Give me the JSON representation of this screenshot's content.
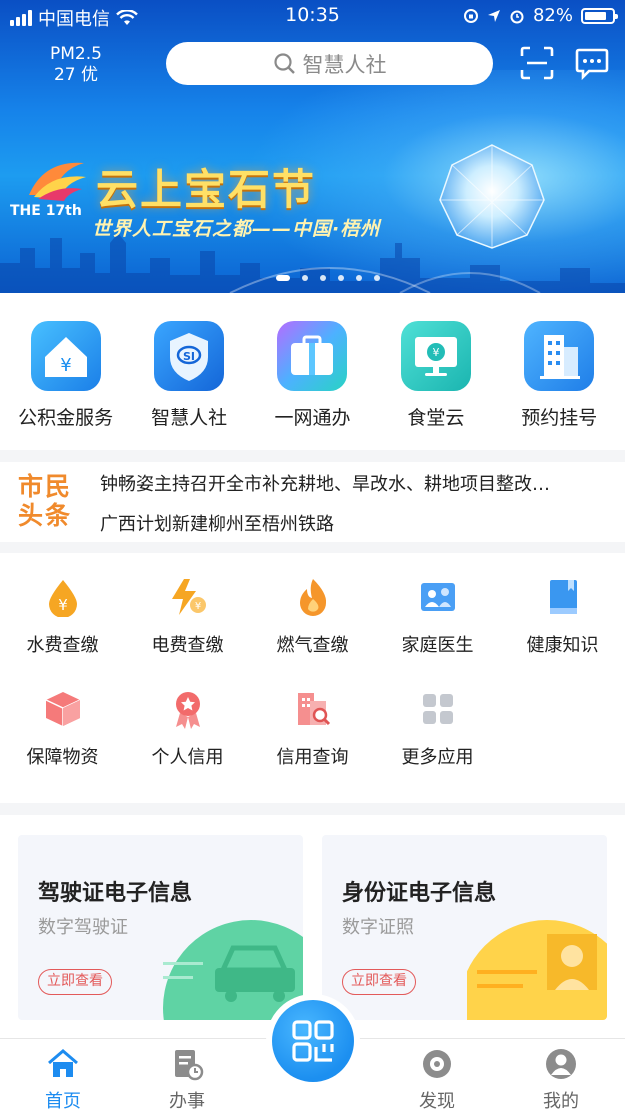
{
  "status": {
    "carrier": "中国电信",
    "time": "10:35",
    "battery": "82%",
    "battery_level": 0.82
  },
  "header": {
    "pm_label": "PM2.5",
    "pm_value": "27 优",
    "search_placeholder": "智慧人社"
  },
  "banner": {
    "title": "云上宝石节",
    "subtitle": "世界人工宝石之都——中国·梧州",
    "logo_text": "THE 17th",
    "page_count": 6,
    "active_page": 0
  },
  "services": [
    {
      "label": "公积金服务",
      "icon": "fund-house-icon"
    },
    {
      "label": "智慧人社",
      "icon": "social-security-shield-icon"
    },
    {
      "label": "一网通办",
      "icon": "briefcase-icon"
    },
    {
      "label": "食堂云",
      "icon": "canteen-screen-icon"
    },
    {
      "label": "预约挂号",
      "icon": "hospital-building-icon"
    }
  ],
  "news": {
    "brand_line1": "市民",
    "brand_line2": "头条",
    "items": [
      "钟畅姿主持召开全市补充耕地、旱改水、耕地项目整改…",
      "广西计划新建柳州至梧州铁路"
    ]
  },
  "apps": [
    {
      "label": "水费查缴",
      "icon": "water-drop-icon"
    },
    {
      "label": "电费查缴",
      "icon": "lightning-icon"
    },
    {
      "label": "燃气查缴",
      "icon": "flame-icon"
    },
    {
      "label": "家庭医生",
      "icon": "family-doctor-icon"
    },
    {
      "label": "健康知识",
      "icon": "book-icon"
    },
    {
      "label": "保障物资",
      "icon": "supply-box-icon"
    },
    {
      "label": "个人信用",
      "icon": "credit-badge-icon"
    },
    {
      "label": "信用查询",
      "icon": "credit-search-icon"
    },
    {
      "label": "更多应用",
      "icon": "grid-more-icon"
    }
  ],
  "cards": [
    {
      "title": "驾驶证电子信息",
      "subtitle": "数字驾驶证",
      "button": "立即查看"
    },
    {
      "title": "身份证电子信息",
      "subtitle": "数字证照",
      "button": "立即查看"
    }
  ],
  "tabs": [
    {
      "label": "首页",
      "icon": "home-icon",
      "active": true
    },
    {
      "label": "办事",
      "icon": "tasks-icon",
      "active": false
    },
    {
      "label": "发现",
      "icon": "discover-icon",
      "active": false
    },
    {
      "label": "我的",
      "icon": "profile-icon",
      "active": false
    }
  ],
  "colors": {
    "accent": "#1d8cf0",
    "news_brand": "#f08a2c",
    "card_button": "#e35a5a"
  }
}
